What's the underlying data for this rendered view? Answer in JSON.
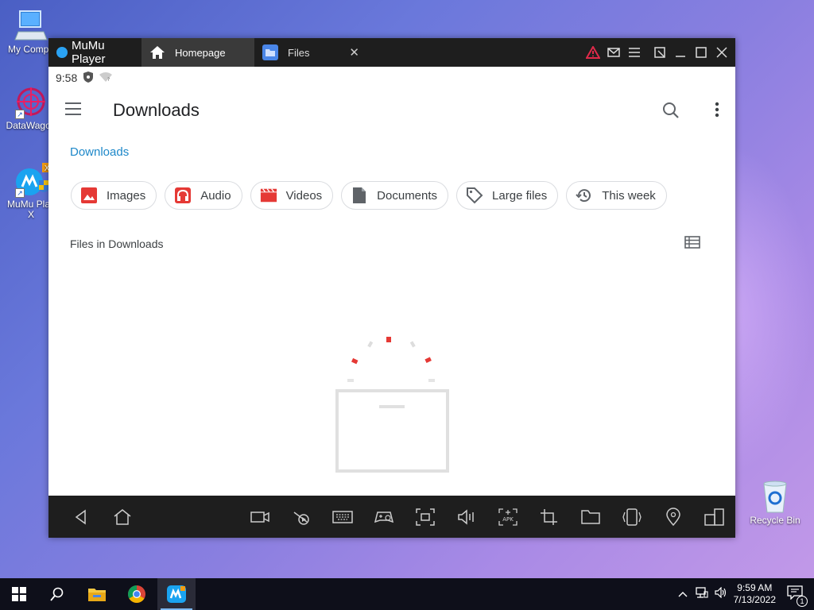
{
  "desktop": {
    "icons": [
      {
        "label": "My Compu",
        "name": "my-computer"
      },
      {
        "label": "DataWagon",
        "name": "datawagon"
      },
      {
        "label": "MuMu Play X",
        "name": "mumu-player-x"
      },
      {
        "label": "Recycle Bin",
        "name": "recycle-bin"
      }
    ]
  },
  "mumu": {
    "app_title": "MuMu Player",
    "tabs": [
      {
        "label": "Homepage",
        "icon": "home-icon"
      },
      {
        "label": "Files",
        "icon": "folder-icon"
      }
    ],
    "alert_color": "#e02a4a"
  },
  "android": {
    "status_time": "9:58",
    "app_title": "Downloads",
    "breadcrumb": "Downloads",
    "chips": [
      {
        "label": "Images",
        "icon": "image-icon",
        "color": "#e53935"
      },
      {
        "label": "Audio",
        "icon": "headphones-icon",
        "color": "#e53935"
      },
      {
        "label": "Videos",
        "icon": "clapper-icon",
        "color": "#e53935"
      },
      {
        "label": "Documents",
        "icon": "document-icon",
        "color": "#5f6368"
      },
      {
        "label": "Large files",
        "icon": "tag-icon",
        "color": "#5f6368"
      },
      {
        "label": "This week",
        "icon": "history-icon",
        "color": "#5f6368"
      }
    ],
    "section_label": "Files in Downloads",
    "accent": "#1e88c9"
  },
  "taskbar": {
    "time": "9:59 AM",
    "date": "7/13/2022",
    "notification_count": "1"
  }
}
